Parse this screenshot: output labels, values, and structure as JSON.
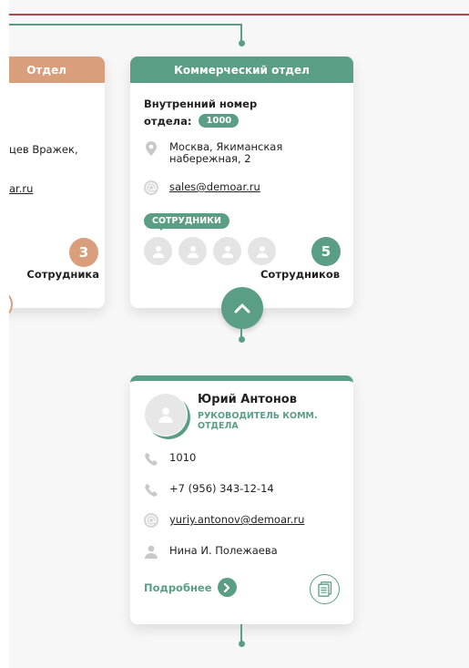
{
  "left_card": {
    "header": "Отдел",
    "address_fragment": "цев Вражек,",
    "email_fragment": "ar.ru",
    "count": "3",
    "count_label": "Сотрудника",
    "header_color": "#d99f7c"
  },
  "commercial_card": {
    "header": "Коммерческий отдел",
    "internal_label_line1": "Внутренний номер",
    "internal_label_line2": "отдела:",
    "internal_number": "1000",
    "address_line1": "Москва, Якиманская",
    "address_line2": "набережная, 2",
    "email": "sales@demoar.ru",
    "employees_tag": "СОТРУДНИКИ",
    "count": "5",
    "count_label": "Сотрудников",
    "accent_color": "#5a9e86"
  },
  "person_card": {
    "name": "Юрий Антонов",
    "role_line1": "РУКОВОДИТЕЛЬ КОММ.",
    "role_line2": "ОТДЕЛА",
    "internal_phone": "1010",
    "phone": "+7 (956) 343-12-14",
    "email": "yuriy.antonov@demoar.ru",
    "assistant": "Нина И. Полежаева",
    "more_label": "Подробнее"
  },
  "icons": {
    "location": "location-pin-icon",
    "email": "at-sign-icon",
    "phone": "phone-icon",
    "person": "person-icon",
    "collapse": "chevron-up-icon",
    "arrow": "arrow-right-icon",
    "document": "document-icon"
  }
}
